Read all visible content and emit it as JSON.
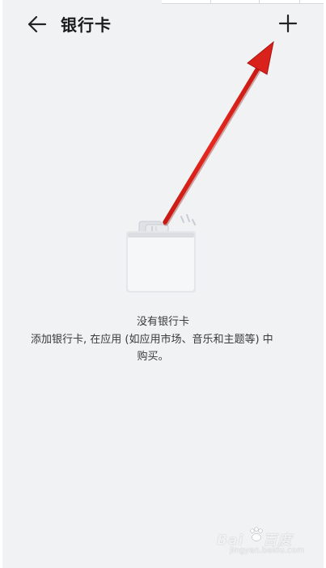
{
  "header": {
    "back_icon": "arrow-left-icon",
    "title": "银行卡",
    "add_icon": "plus-icon"
  },
  "empty_state": {
    "illustration": "card-wallet-icon",
    "title": "没有银行卡",
    "description_line1": "添加银行卡, 在应用 (如应用市场、音乐和主题等) 中",
    "description_line2": "购买。"
  },
  "annotation": {
    "color": "#e0231f"
  },
  "watermark": {
    "brand": "Bai",
    "brand_suffix": "百度",
    "subtext": "jingyan.baidu.com"
  },
  "colors": {
    "background": "#f1f2f4",
    "text_primary": "#1b1b1b",
    "text_secondary": "#3a3a3a"
  }
}
